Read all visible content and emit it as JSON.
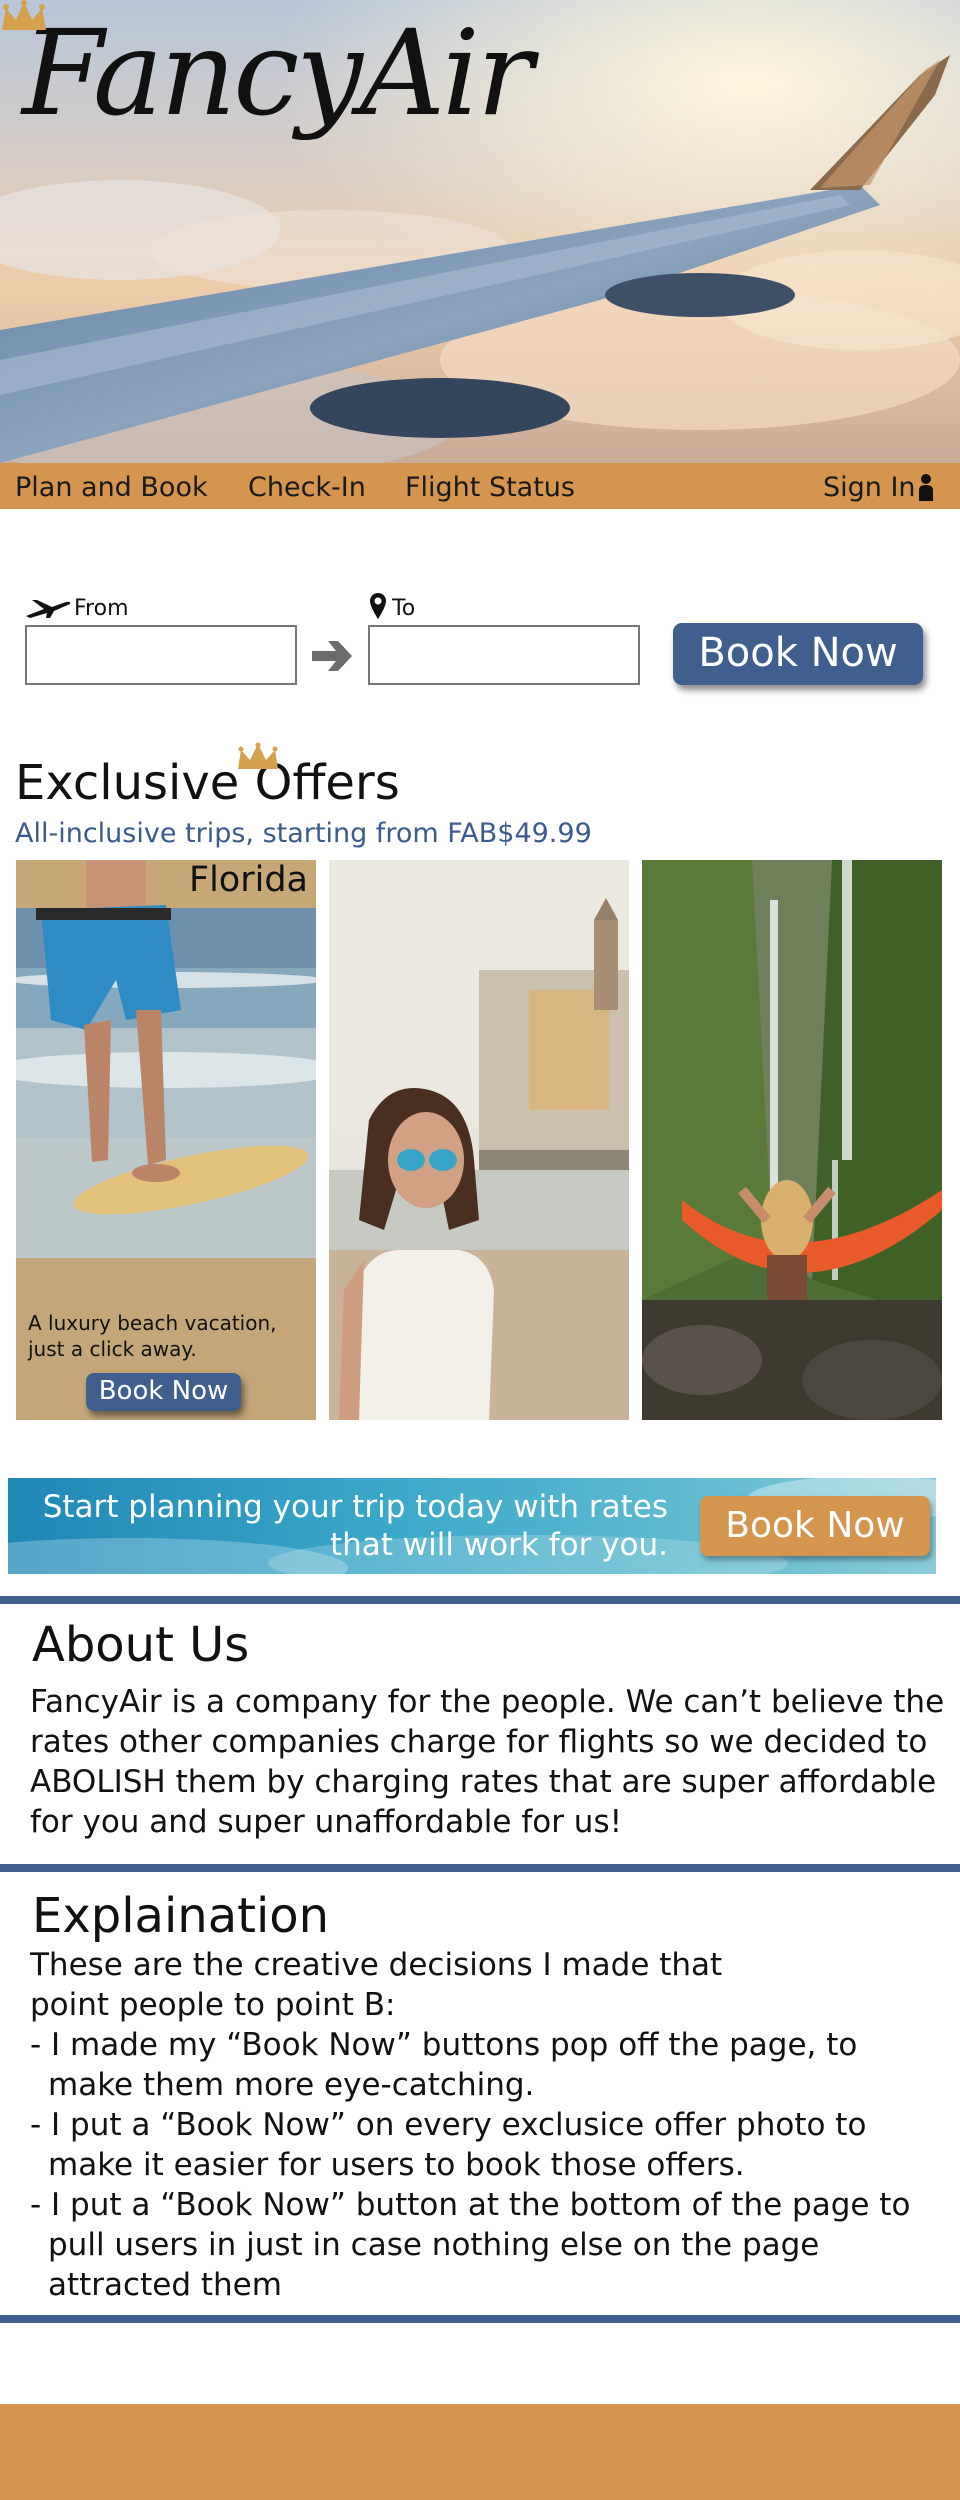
{
  "brand": {
    "logo_text": "FancyAir"
  },
  "nav": {
    "items": [
      {
        "label": "Plan and Book"
      },
      {
        "label": "Check-In"
      },
      {
        "label": "Flight Status"
      }
    ],
    "sign_in": "Sign In"
  },
  "booking": {
    "from_label": "From",
    "to_label": "To",
    "from_value": "",
    "to_value": "",
    "book_button": "Book Now"
  },
  "offers": {
    "title": "Exclusive Offers",
    "subtitle": "All-inclusive trips, starting from FAB$49.99",
    "cards": [
      {
        "title": "Florida",
        "text": "A luxury beach vacation, just a click away.",
        "button": "Book Now"
      },
      {
        "title": "",
        "text": "",
        "button": ""
      },
      {
        "title": "",
        "text": "",
        "button": ""
      }
    ]
  },
  "banner": {
    "text": "Start planning your trip today with rates that will work for you.",
    "button": "Book Now"
  },
  "about": {
    "title": "About Us",
    "text": "FancyAir is a company for the people. We can’t believe the rates other companies charge for flights so we decided to ABOLISH them by charging rates that are super affordable for you and super unaffordable for us!"
  },
  "explanation": {
    "title": "Explaination",
    "intro": "These are the creative decisions I made that point people to point B:",
    "items": [
      "- I made my “Book Now” buttons pop off the page, to make them more eye-catching.",
      "- I put a “Book Now” on every exclusice offer photo to make it easier for users to book those offers.",
      "- I put a “Book Now” button at the bottom of the page to pull users in just in case nothing else on the page attracted them"
    ]
  },
  "colors": {
    "accent_orange": "#d4964e",
    "accent_blue": "#3f5f8f",
    "subtitle_blue": "#3b5b8c"
  },
  "icons": [
    "plane-icon",
    "location-pin-icon",
    "arrow-right-icon",
    "user-icon",
    "crown-icon"
  ]
}
